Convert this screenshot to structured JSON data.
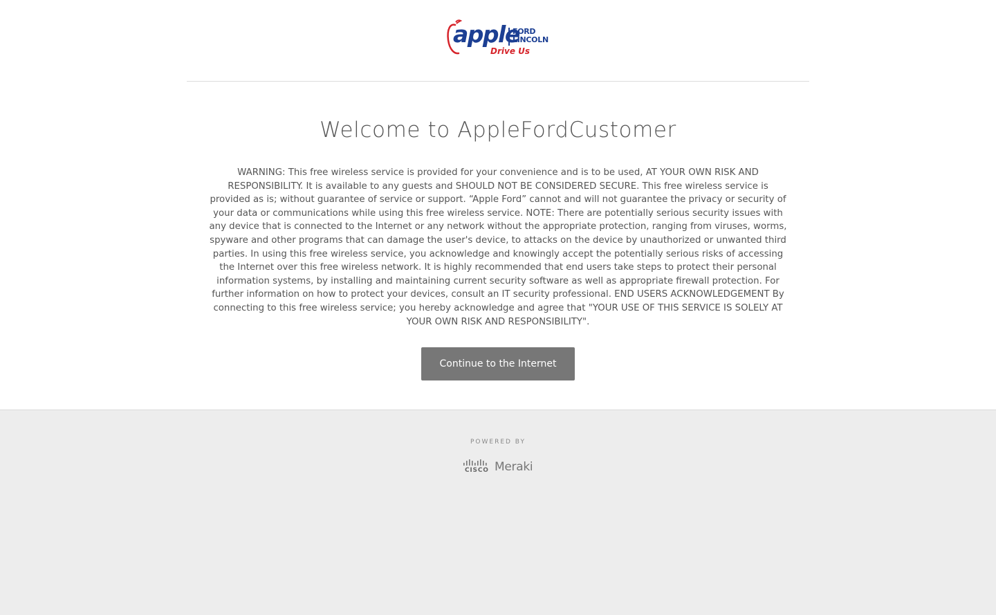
{
  "logo": {
    "brand": "apple",
    "line1": "FORD",
    "line2": "LINCOLN",
    "tagline": "Drive Us",
    "colors": {
      "blue": "#1c3f93",
      "red": "#d6232a"
    }
  },
  "main": {
    "title": "Welcome to AppleFordCustomer",
    "warning": "WARNING: This free wireless service is provided for your convenience and is to be used, AT YOUR OWN RISK AND RESPONSIBILITY. It is available to any guests and SHOULD NOT BE CONSIDERED SECURE. This free wireless service is provided as is; without guarantee of service or support. “Apple Ford” cannot and will not guarantee the privacy or security of your data or communications while using this free wireless service. NOTE: There are potentially serious security issues with any device that is connected to the Internet or any network without the appropriate protection, ranging from viruses, worms, spyware and other programs that can damage the user's device, to attacks on the device by unauthorized or unwanted third parties. In using this free wireless service, you acknowledge and knowingly accept the potentially serious risks of accessing the Internet over this free wireless network. It is highly recommended that end users take steps to protect their personal information systems, by installing and maintaining current security software as well as appropriate firewall protection. For further information on how to protect your devices, consult an IT security professional. END USERS ACKNOWLEDGEMENT By connecting to this free wireless service; you hereby acknowledge and agree that \"YOUR USE OF THIS SERVICE IS SOLELY AT YOUR OWN RISK AND RESPONSIBILITY\".",
    "continue_label": "Continue to the Internet",
    "button_color": "#777777"
  },
  "footer": {
    "powered_by": "POWERED BY",
    "cisco": "CISCO",
    "meraki": "Meraki",
    "icon": "cisco-bars-icon",
    "background": "#ededed"
  }
}
